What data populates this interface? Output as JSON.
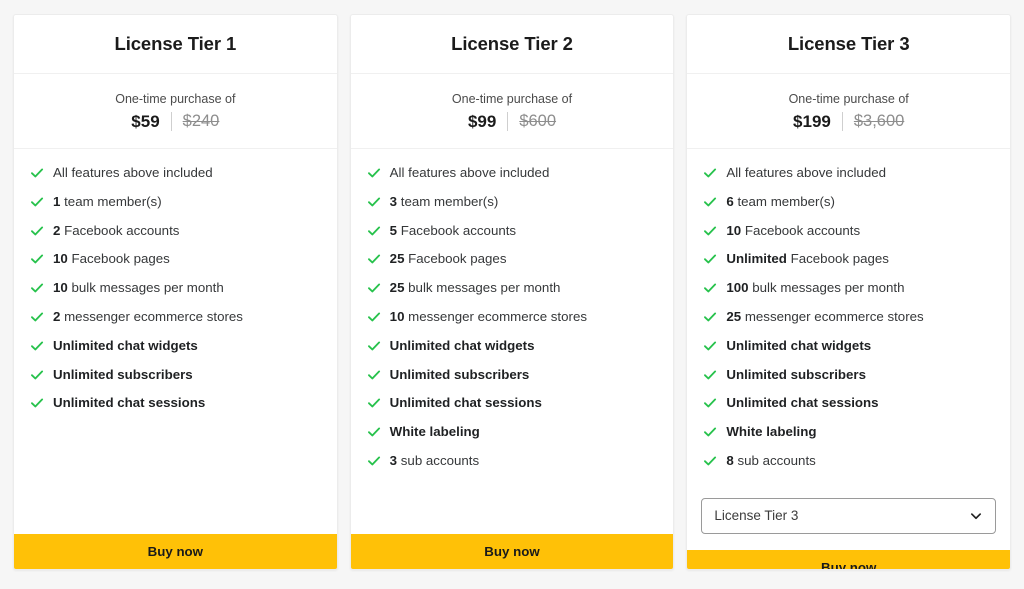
{
  "page": {
    "background_color": "#f6f6f6",
    "accent_button_color": "#ffc107",
    "check_color": "#27c24c"
  },
  "tiers": [
    {
      "title": "License Tier 1",
      "price_caption": "One-time purchase of",
      "price_current": "$59",
      "price_original": "$240",
      "features": [
        {
          "lead": "",
          "rest": "All features above included",
          "bold_all": false
        },
        {
          "lead": "1",
          "rest": " team member(s)",
          "bold_all": false
        },
        {
          "lead": "2",
          "rest": " Facebook accounts",
          "bold_all": false
        },
        {
          "lead": "10",
          "rest": " Facebook pages",
          "bold_all": false
        },
        {
          "lead": "10",
          "rest": " bulk messages per month",
          "bold_all": false
        },
        {
          "lead": "2",
          "rest": " messenger ecommerce stores",
          "bold_all": false
        },
        {
          "lead": "",
          "rest": "Unlimited chat widgets",
          "bold_all": true
        },
        {
          "lead": "",
          "rest": "Unlimited subscribers",
          "bold_all": true
        },
        {
          "lead": "",
          "rest": "Unlimited chat sessions",
          "bold_all": true
        }
      ],
      "has_select": false,
      "select_value": "",
      "buy_label": "Buy now"
    },
    {
      "title": "License Tier 2",
      "price_caption": "One-time purchase of",
      "price_current": "$99",
      "price_original": "$600",
      "features": [
        {
          "lead": "",
          "rest": "All features above included",
          "bold_all": false
        },
        {
          "lead": "3",
          "rest": " team member(s)",
          "bold_all": false
        },
        {
          "lead": "5",
          "rest": " Facebook accounts",
          "bold_all": false
        },
        {
          "lead": "25",
          "rest": " Facebook pages",
          "bold_all": false
        },
        {
          "lead": "25",
          "rest": " bulk messages per month",
          "bold_all": false
        },
        {
          "lead": "10",
          "rest": " messenger ecommerce stores",
          "bold_all": false
        },
        {
          "lead": "",
          "rest": "Unlimited chat widgets",
          "bold_all": true
        },
        {
          "lead": "",
          "rest": "Unlimited subscribers",
          "bold_all": true
        },
        {
          "lead": "",
          "rest": "Unlimited chat sessions",
          "bold_all": true
        },
        {
          "lead": "",
          "rest": "White labeling",
          "bold_all": true
        },
        {
          "lead": "3",
          "rest": " sub accounts",
          "bold_all": false
        }
      ],
      "has_select": false,
      "select_value": "",
      "buy_label": "Buy now"
    },
    {
      "title": "License Tier 3",
      "price_caption": "One-time purchase of",
      "price_current": "$199",
      "price_original": "$3,600",
      "features": [
        {
          "lead": "",
          "rest": "All features above included",
          "bold_all": false
        },
        {
          "lead": "6",
          "rest": " team member(s)",
          "bold_all": false
        },
        {
          "lead": "10",
          "rest": " Facebook accounts",
          "bold_all": false
        },
        {
          "lead": "Unlimited",
          "rest": " Facebook pages",
          "bold_all": false
        },
        {
          "lead": "100",
          "rest": " bulk messages per month",
          "bold_all": false
        },
        {
          "lead": "25",
          "rest": " messenger ecommerce stores",
          "bold_all": false
        },
        {
          "lead": "",
          "rest": "Unlimited chat widgets",
          "bold_all": true
        },
        {
          "lead": "",
          "rest": "Unlimited subscribers",
          "bold_all": true
        },
        {
          "lead": "",
          "rest": "Unlimited chat sessions",
          "bold_all": true
        },
        {
          "lead": "",
          "rest": "White labeling",
          "bold_all": true
        },
        {
          "lead": "8",
          "rest": " sub accounts",
          "bold_all": false
        }
      ],
      "has_select": true,
      "select_value": "License Tier 3",
      "buy_label": "Buy now"
    }
  ]
}
